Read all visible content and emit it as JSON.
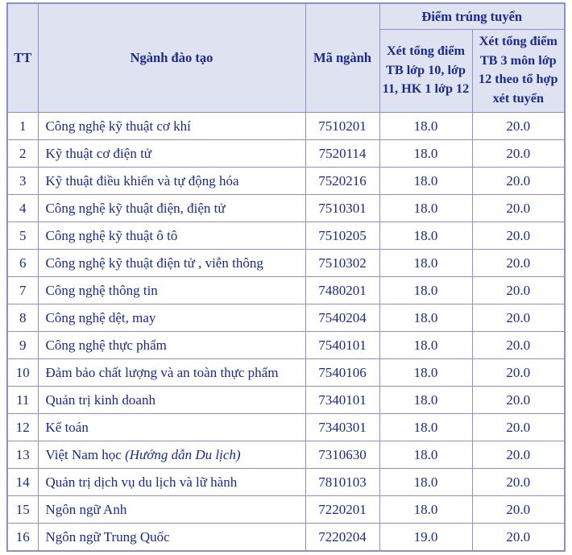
{
  "table": {
    "columns": {
      "tt": "TT",
      "name": "Ngành đào tạo",
      "code": "Mã ngành",
      "score_group": "Điểm trúng tuyển",
      "score_a": "Xét tổng điểm TB lớp 10, lớp 11, HK 1 lớp 12",
      "score_b": "Xét tổng điểm TB 3 môn lớp 12 theo tổ hợp xét tuyển"
    },
    "colors": {
      "header_background": "#dfe3f1",
      "text": "#1b2a8a",
      "border": "#8b90c8",
      "body_background": "#ffffff"
    },
    "rows": [
      {
        "tt": "1",
        "name": "Công nghệ kỹ thuật cơ khí",
        "name_italic": "",
        "code": "7510201",
        "score_a": "18.0",
        "score_b": "20.0"
      },
      {
        "tt": "2",
        "name": "Kỹ thuật cơ điện tử",
        "name_italic": "",
        "code": "7520114",
        "score_a": "18.0",
        "score_b": "20.0"
      },
      {
        "tt": "3",
        "name": "Kỹ thuật điều khiển và tự động hóa",
        "name_italic": "",
        "code": "7520216",
        "score_a": "18.0",
        "score_b": "20.0"
      },
      {
        "tt": "4",
        "name": "Công nghệ kỹ thuật điện, điện tử",
        "name_italic": "",
        "code": "7510301",
        "score_a": "18.0",
        "score_b": "20.0"
      },
      {
        "tt": "5",
        "name": "Công nghệ kỹ thuật ô tô",
        "name_italic": "",
        "code": "7510205",
        "score_a": "18.0",
        "score_b": "20.0"
      },
      {
        "tt": "6",
        "name": "Công nghệ kỹ thuật điện tử , viễn thông",
        "name_italic": "",
        "code": "7510302",
        "score_a": "18.0",
        "score_b": "20.0"
      },
      {
        "tt": "7",
        "name": "Công nghệ thông tin",
        "name_italic": "",
        "code": "7480201",
        "score_a": "18.0",
        "score_b": "20.0"
      },
      {
        "tt": "8",
        "name": "Công nghệ dệt, may",
        "name_italic": "",
        "code": "7540204",
        "score_a": "18.0",
        "score_b": "20.0"
      },
      {
        "tt": "9",
        "name": "Công nghệ thực phẩm",
        "name_italic": "",
        "code": "7540101",
        "score_a": "18.0",
        "score_b": "20.0"
      },
      {
        "tt": "10",
        "name": "Đảm bảo chất lượng và an toàn thực phẩm",
        "name_italic": "",
        "code": "7540106",
        "score_a": "18.0",
        "score_b": "20.0"
      },
      {
        "tt": "11",
        "name": "Quản trị kinh doanh",
        "name_italic": "",
        "code": "7340101",
        "score_a": "18.0",
        "score_b": "20.0"
      },
      {
        "tt": "12",
        "name": "Kế toán",
        "name_italic": "",
        "code": "7340301",
        "score_a": "18.0",
        "score_b": "20.0"
      },
      {
        "tt": "13",
        "name": "Việt Nam học ",
        "name_italic": "(Hướng dẫn Du lịch)",
        "code": "7310630",
        "score_a": "18.0",
        "score_b": "20.0"
      },
      {
        "tt": "14",
        "name": "Quản trị dịch vụ du lịch và lữ hành",
        "name_italic": "",
        "code": "7810103",
        "score_a": "18.0",
        "score_b": "20.0"
      },
      {
        "tt": "15",
        "name": "Ngôn ngữ Anh",
        "name_italic": "",
        "code": "7220201",
        "score_a": "18.0",
        "score_b": "20.0"
      },
      {
        "tt": "16",
        "name": "Ngôn ngữ Trung Quốc",
        "name_italic": "",
        "code": "7220204",
        "score_a": "19.0",
        "score_b": "20.0"
      }
    ]
  }
}
